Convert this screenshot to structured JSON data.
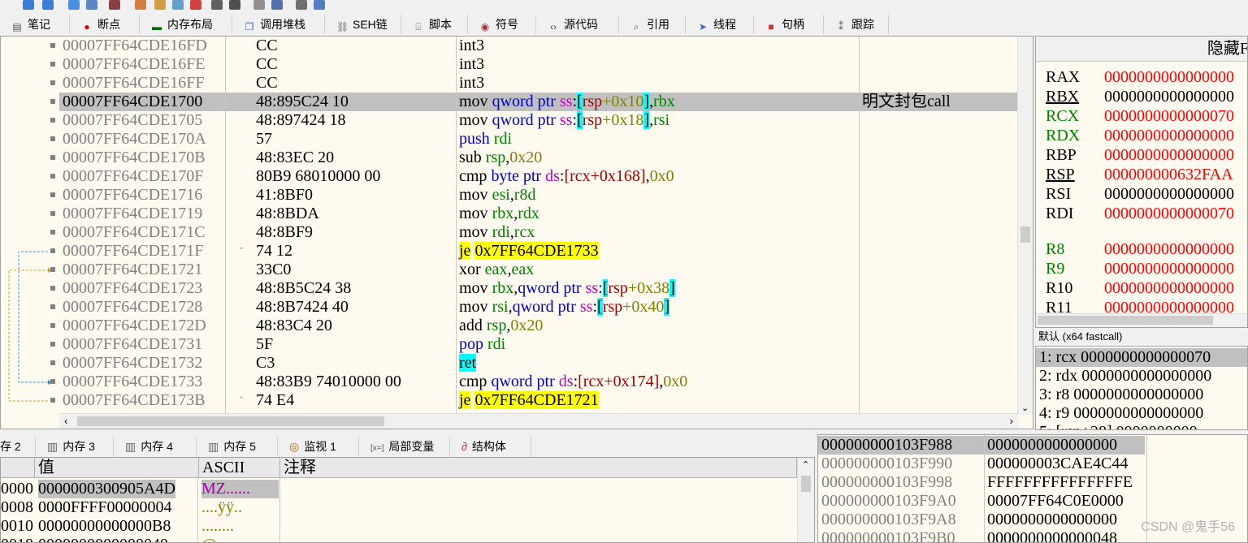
{
  "tabs": [
    {
      "label": "笔记",
      "icon": "notes-icon"
    },
    {
      "label": "断点",
      "icon": "breakpoint-icon"
    },
    {
      "label": "内存布局",
      "icon": "memory-map-icon"
    },
    {
      "label": "调用堆栈",
      "icon": "callstack-icon"
    },
    {
      "label": "SEH链",
      "icon": "seh-icon"
    },
    {
      "label": "脚本",
      "icon": "script-icon"
    },
    {
      "label": "符号",
      "icon": "symbols-icon"
    },
    {
      "label": "源代码",
      "icon": "source-icon"
    },
    {
      "label": "引用",
      "icon": "references-icon"
    },
    {
      "label": "线程",
      "icon": "threads-icon"
    },
    {
      "label": "句柄",
      "icon": "handles-icon"
    },
    {
      "label": "跟踪",
      "icon": "trace-icon"
    }
  ],
  "cpu": {
    "rows": [
      {
        "addr": "00007FF64CDE16FD",
        "bytes": "CC",
        "dis": [
          [
            "int3",
            "op"
          ]
        ],
        "cmt": ""
      },
      {
        "addr": "00007FF64CDE16FE",
        "bytes": "CC",
        "dis": [
          [
            "int3",
            "op"
          ]
        ],
        "cmt": ""
      },
      {
        "addr": "00007FF64CDE16FF",
        "bytes": "CC",
        "dis": [
          [
            "int3",
            "op"
          ]
        ],
        "cmt": ""
      },
      {
        "addr": "00007FF64CDE1700",
        "bytes": "48:895C24 10",
        "dis": [
          [
            "mov ",
            "op"
          ],
          [
            "qword ptr ",
            "blue"
          ],
          [
            "ss",
            "seg"
          ],
          [
            ":",
            "op"
          ],
          [
            "[",
            "cyan"
          ],
          [
            "rsp",
            "mem"
          ],
          [
            "+0x10",
            "num"
          ],
          [
            "]",
            "cyan"
          ],
          [
            ",",
            "op"
          ],
          [
            "rbx",
            "reg"
          ]
        ],
        "cmt": "明文封包call",
        "sel": true
      },
      {
        "addr": "00007FF64CDE1705",
        "bytes": "48:897424 18",
        "dis": [
          [
            "mov ",
            "op"
          ],
          [
            "qword ptr ",
            "blue"
          ],
          [
            "ss",
            "seg"
          ],
          [
            ":",
            "op"
          ],
          [
            "[",
            "cyan"
          ],
          [
            "rsp",
            "mem"
          ],
          [
            "+0x18",
            "num"
          ],
          [
            "]",
            "cyan"
          ],
          [
            ",",
            "op"
          ],
          [
            "rsi",
            "reg"
          ]
        ],
        "cmt": ""
      },
      {
        "addr": "00007FF64CDE170A",
        "bytes": "57",
        "dis": [
          [
            "push ",
            "blue"
          ],
          [
            "rdi",
            "reg"
          ]
        ],
        "cmt": ""
      },
      {
        "addr": "00007FF64CDE170B",
        "bytes": "48:83EC 20",
        "dis": [
          [
            "sub ",
            "op"
          ],
          [
            "rsp",
            "reg"
          ],
          [
            ",",
            "op"
          ],
          [
            "0x20",
            "num"
          ]
        ],
        "cmt": ""
      },
      {
        "addr": "00007FF64CDE170F",
        "bytes": "80B9 68010000 00",
        "dis": [
          [
            "cmp ",
            "op"
          ],
          [
            "byte ptr ",
            "blue"
          ],
          [
            "ds",
            "seg"
          ],
          [
            ":",
            "op"
          ],
          [
            "[rcx+0x168]",
            "mem"
          ],
          [
            ",",
            "op"
          ],
          [
            "0x0",
            "num"
          ]
        ],
        "cmt": ""
      },
      {
        "addr": "00007FF64CDE1716",
        "bytes": "41:8BF0",
        "dis": [
          [
            "mov ",
            "op"
          ],
          [
            "esi",
            "reg"
          ],
          [
            ",",
            "op"
          ],
          [
            "r8d",
            "reg"
          ]
        ],
        "cmt": ""
      },
      {
        "addr": "00007FF64CDE1719",
        "bytes": "48:8BDA",
        "dis": [
          [
            "mov ",
            "op"
          ],
          [
            "rbx",
            "reg"
          ],
          [
            ",",
            "op"
          ],
          [
            "rdx",
            "reg"
          ]
        ],
        "cmt": ""
      },
      {
        "addr": "00007FF64CDE171C",
        "bytes": "48:8BF9",
        "dis": [
          [
            "mov ",
            "op"
          ],
          [
            "rdi",
            "reg"
          ],
          [
            ",",
            "op"
          ],
          [
            "rcx",
            "reg"
          ]
        ],
        "cmt": ""
      },
      {
        "addr": "00007FF64CDE171F",
        "bytes": "74 12",
        "dis": [
          [
            "je",
            "jmp"
          ],
          [
            " ",
            "op"
          ],
          [
            "0x7FF64CDE1733",
            "jmp"
          ]
        ],
        "cmt": "",
        "jmark": "ˇ"
      },
      {
        "addr": "00007FF64CDE1721",
        "bytes": "33C0",
        "dis": [
          [
            "xor ",
            "op"
          ],
          [
            "eax",
            "reg"
          ],
          [
            ",",
            "op"
          ],
          [
            "eax",
            "reg"
          ]
        ],
        "cmt": ""
      },
      {
        "addr": "00007FF64CDE1723",
        "bytes": "48:8B5C24 38",
        "dis": [
          [
            "mov ",
            "op"
          ],
          [
            "rbx",
            "reg"
          ],
          [
            ",",
            "op"
          ],
          [
            "qword ptr ",
            "blue"
          ],
          [
            "ss",
            "seg"
          ],
          [
            ":",
            "op"
          ],
          [
            "[",
            "cyan"
          ],
          [
            "rsp",
            "mem"
          ],
          [
            "+0x38",
            "num"
          ],
          [
            "]",
            "cyan"
          ]
        ],
        "cmt": ""
      },
      {
        "addr": "00007FF64CDE1728",
        "bytes": "48:8B7424 40",
        "dis": [
          [
            "mov ",
            "op"
          ],
          [
            "rsi",
            "reg"
          ],
          [
            ",",
            "op"
          ],
          [
            "qword ptr ",
            "blue"
          ],
          [
            "ss",
            "seg"
          ],
          [
            ":",
            "op"
          ],
          [
            "[",
            "cyan"
          ],
          [
            "rsp",
            "mem"
          ],
          [
            "+0x40",
            "num"
          ],
          [
            "]",
            "cyan"
          ]
        ],
        "cmt": ""
      },
      {
        "addr": "00007FF64CDE172D",
        "bytes": "48:83C4 20",
        "dis": [
          [
            "add ",
            "op"
          ],
          [
            "rsp",
            "reg"
          ],
          [
            ",",
            "op"
          ],
          [
            "0x20",
            "num"
          ]
        ],
        "cmt": ""
      },
      {
        "addr": "00007FF64CDE1731",
        "bytes": "5F",
        "dis": [
          [
            "pop ",
            "blue"
          ],
          [
            "rdi",
            "reg"
          ]
        ],
        "cmt": ""
      },
      {
        "addr": "00007FF64CDE1732",
        "bytes": "C3",
        "dis": [
          [
            "ret",
            "ret"
          ]
        ],
        "cmt": ""
      },
      {
        "addr": "00007FF64CDE1733",
        "bytes": "48:83B9 74010000 00",
        "dis": [
          [
            "cmp ",
            "op"
          ],
          [
            "qword ptr ",
            "blue"
          ],
          [
            "ds",
            "seg"
          ],
          [
            ":",
            "op"
          ],
          [
            "[rcx+0x174]",
            "mem"
          ],
          [
            ",",
            "op"
          ],
          [
            "0x0",
            "num"
          ]
        ],
        "cmt": ""
      },
      {
        "addr": "00007FF64CDE173B",
        "bytes": "74 E4",
        "dis": [
          [
            "je",
            "jmp"
          ],
          [
            " ",
            "op"
          ],
          [
            "0x7FF64CDE1721",
            "jmp"
          ]
        ],
        "cmt": "",
        "jmark": "ˆ"
      }
    ]
  },
  "registers": {
    "header": "隐藏F",
    "list": [
      {
        "name": "RAX",
        "value": "0000000000000000",
        "name_color": "black",
        "value_color": "red"
      },
      {
        "name": "RBX",
        "value": "0000000000000000",
        "name_color": "black",
        "value_color": "black",
        "underline": true
      },
      {
        "name": "RCX",
        "value": "0000000000000070",
        "name_color": "green",
        "value_color": "red"
      },
      {
        "name": "RDX",
        "value": "0000000000000000",
        "name_color": "green",
        "value_color": "red"
      },
      {
        "name": "RBP",
        "value": "0000000000000000",
        "name_color": "black",
        "value_color": "red"
      },
      {
        "name": "RSP",
        "value": "000000000632FAA",
        "name_color": "black",
        "value_color": "red",
        "underline": true
      },
      {
        "name": "RSI",
        "value": "0000000000000000",
        "name_color": "black",
        "value_color": "black"
      },
      {
        "name": "RDI",
        "value": "0000000000000070",
        "name_color": "black",
        "value_color": "red"
      },
      {
        "name": "R8",
        "value": "0000000000000000",
        "name_color": "green",
        "value_color": "red"
      },
      {
        "name": "R9",
        "value": "0000000000000000",
        "name_color": "green",
        "value_color": "red"
      },
      {
        "name": "R10",
        "value": "0000000000000000",
        "name_color": "black",
        "value_color": "red"
      },
      {
        "name": "R11",
        "value": "0000000000000000",
        "name_color": "black",
        "value_color": "red"
      }
    ]
  },
  "calls": {
    "header": "默认 (x64 fastcall)",
    "args": [
      "1: rcx 0000000000000070",
      "2: rdx 0000000000000000",
      "3: r8 0000000000000000",
      "4: r9 0000000000000000",
      "5: [rsp+28] 0000000000"
    ]
  },
  "bottom_tabs": [
    "存 2",
    "内存 3",
    "内存 4",
    "内存 5",
    "监视 1",
    "局部变量",
    "结构体"
  ],
  "dump": {
    "headers": [
      "",
      "值",
      "ASCII",
      "注释"
    ],
    "rows": [
      {
        "addr": "0000",
        "value": "0000000300905A4D",
        "ascii": "MZ......",
        "sel": true
      },
      {
        "addr": "0008",
        "value": "0000FFFF00000004",
        "ascii": "....ÿÿ.."
      },
      {
        "addr": "0010",
        "value": "00000000000000B8",
        "ascii": "........"
      },
      {
        "addr": "0018",
        "value": "0000000000000040",
        "ascii": "@......."
      }
    ]
  },
  "stack": {
    "rows": [
      {
        "addr": "000000000103F988",
        "value": "0000000000000000",
        "sel": true
      },
      {
        "addr": "000000000103F990",
        "value": "000000003CAE4C44"
      },
      {
        "addr": "000000000103F998",
        "value": "FFFFFFFFFFFFFFFE"
      },
      {
        "addr": "000000000103F9A0",
        "value": "00007FF64C0E0000"
      },
      {
        "addr": "000000000103F9A8",
        "value": "0000000000000000"
      },
      {
        "addr": "000000000103F9B0",
        "value": "0000000000000048"
      }
    ]
  },
  "watermark": "CSDN @鬼手56"
}
